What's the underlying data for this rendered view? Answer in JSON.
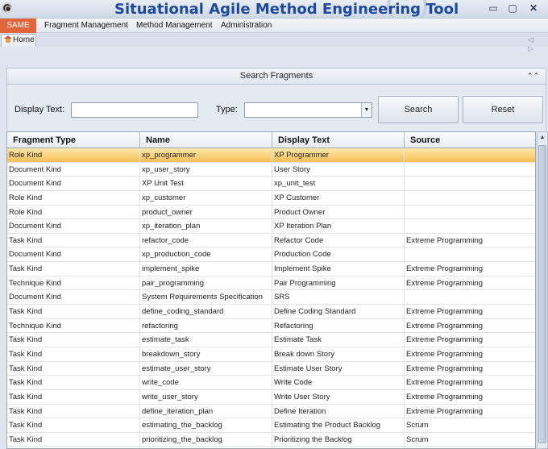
{
  "window": {
    "title": "Situational Agile Method Engineering Tool",
    "minimize": "▭",
    "maximize": "▢",
    "close": "✕"
  },
  "menu": {
    "brand": "SAME",
    "items": [
      "Fragment Management",
      "Method Management",
      "Administration"
    ]
  },
  "tabs": {
    "home": "Home",
    "nav": "◁ ▷"
  },
  "search_panel": {
    "title": "Search Fragments",
    "collapse": "⌃⌃",
    "display_text_label": "Display Text:",
    "display_text_value": "",
    "type_label": "Type:",
    "type_value": "",
    "combo_arrow": "▼",
    "search_button": "Search",
    "reset_button": "Reset"
  },
  "grid": {
    "columns": [
      "Fragment Type",
      "Name",
      "Display Text",
      "Source"
    ],
    "rows": [
      [
        "Role Kind",
        "xp_programmer",
        "XP Programmer",
        ""
      ],
      [
        "Document Kind",
        "xp_user_story",
        "User Story",
        ""
      ],
      [
        "Document Kind",
        "XP Unit Test",
        "xp_unit_test",
        ""
      ],
      [
        "Role Kind",
        "xp_customer",
        "XP Customer",
        ""
      ],
      [
        "Role Kind",
        "product_owner",
        "Product Owner",
        ""
      ],
      [
        "Document Kind",
        "xp_iteration_plan",
        "XP Iteration Plan",
        ""
      ],
      [
        "Task Kind",
        "refactor_code",
        "Refactor Code",
        "Extreme Programming"
      ],
      [
        "Document Kind",
        "xp_production_code",
        "Production Code",
        ""
      ],
      [
        "Task Kind",
        "implement_spike",
        "Implement Spike",
        "Extreme Programming"
      ],
      [
        "Technique Kind",
        "pair_programming",
        "Pair Programming",
        "Extreme Programming"
      ],
      [
        "Document Kind",
        "System Requirements Specification",
        "SRS",
        ""
      ],
      [
        "Task Kind",
        "define_coding_standard",
        "Define Coding Standard",
        "Extreme Programming"
      ],
      [
        "Technique Kind",
        "refactoring",
        "Refactoring",
        "Extreme Programming"
      ],
      [
        "Task Kind",
        "estimate_task",
        "Estimate Task",
        "Extreme Programming"
      ],
      [
        "Task Kind",
        "breakdown_story",
        "Break down Story",
        "Extreme Programming"
      ],
      [
        "Task Kind",
        "estimate_user_story",
        "Estimate User Story",
        "Extreme Programming"
      ],
      [
        "Task Kind",
        "write_code",
        "Write Code",
        "Extreme Programming"
      ],
      [
        "Task Kind",
        "write_user_story",
        "Write User Story",
        "Extreme Programming"
      ],
      [
        "Task Kind",
        "define_iteration_plan",
        "Define Iteration",
        "Extreme Programming"
      ],
      [
        "Task Kind",
        "estimating_the_backlog",
        "Estimating the Product Backlog",
        "Scrum"
      ],
      [
        "Task Kind",
        "prioritizing_the_backlog",
        "Prioritizing the Backlog",
        "Scrum"
      ],
      [
        "Task Kind",
        "",
        "",
        ""
      ]
    ],
    "selected_row": 0,
    "scroll_up": "▲"
  },
  "colors": {
    "title": "#1d4aa0",
    "brand_bg": "#e0653a",
    "selected_row": "#f7bf57"
  }
}
